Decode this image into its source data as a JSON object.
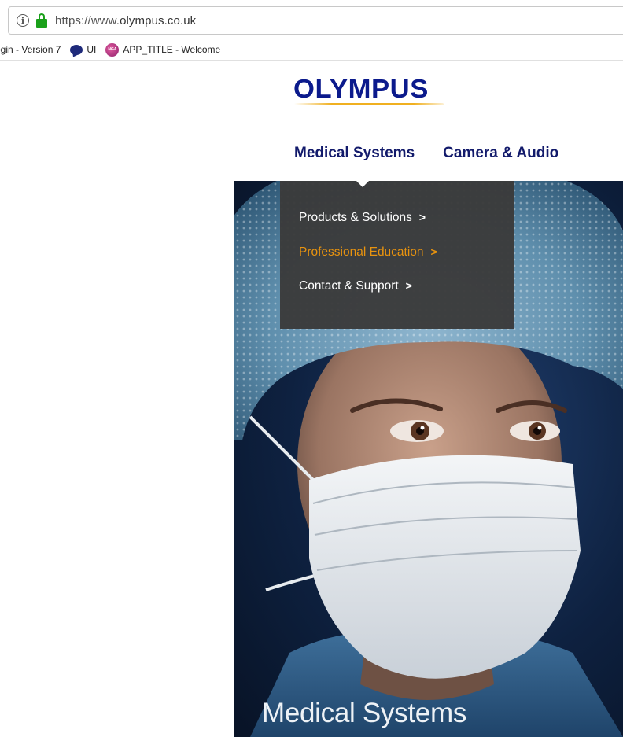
{
  "browser": {
    "url_scheme": "https://www.",
    "url_host": "olympus.co.uk",
    "bookmarks": [
      {
        "label": "ogin - Version 7",
        "icon": "none"
      },
      {
        "label": "UI",
        "icon": "chat-bubble-icon"
      },
      {
        "label": "APP_TITLE - Welcome",
        "icon": "app-badge-icon"
      }
    ],
    "app_badge_text": "NGA"
  },
  "site": {
    "logo_text": "OLYMPUS",
    "nav": [
      {
        "label": "Medical Systems"
      },
      {
        "label": "Camera & Audio"
      }
    ],
    "dropdown": {
      "items": [
        {
          "label": "Products & Solutions",
          "chevron": ">",
          "active": false
        },
        {
          "label": "Professional Education",
          "chevron": ">",
          "active": true
        },
        {
          "label": "Contact & Support",
          "chevron": ">",
          "active": false
        }
      ]
    },
    "hero": {
      "title": "Medical Systems",
      "image_subject": "surgeon-in-mask-image"
    }
  },
  "colors": {
    "brand_blue": "#0b1a8c",
    "nav_text": "#121a6b",
    "accent_orange": "#e8930f",
    "dropdown_bg": "#3a3a3a",
    "secure_green": "#1aa01a",
    "logo_swoosh": "#f0b020"
  }
}
